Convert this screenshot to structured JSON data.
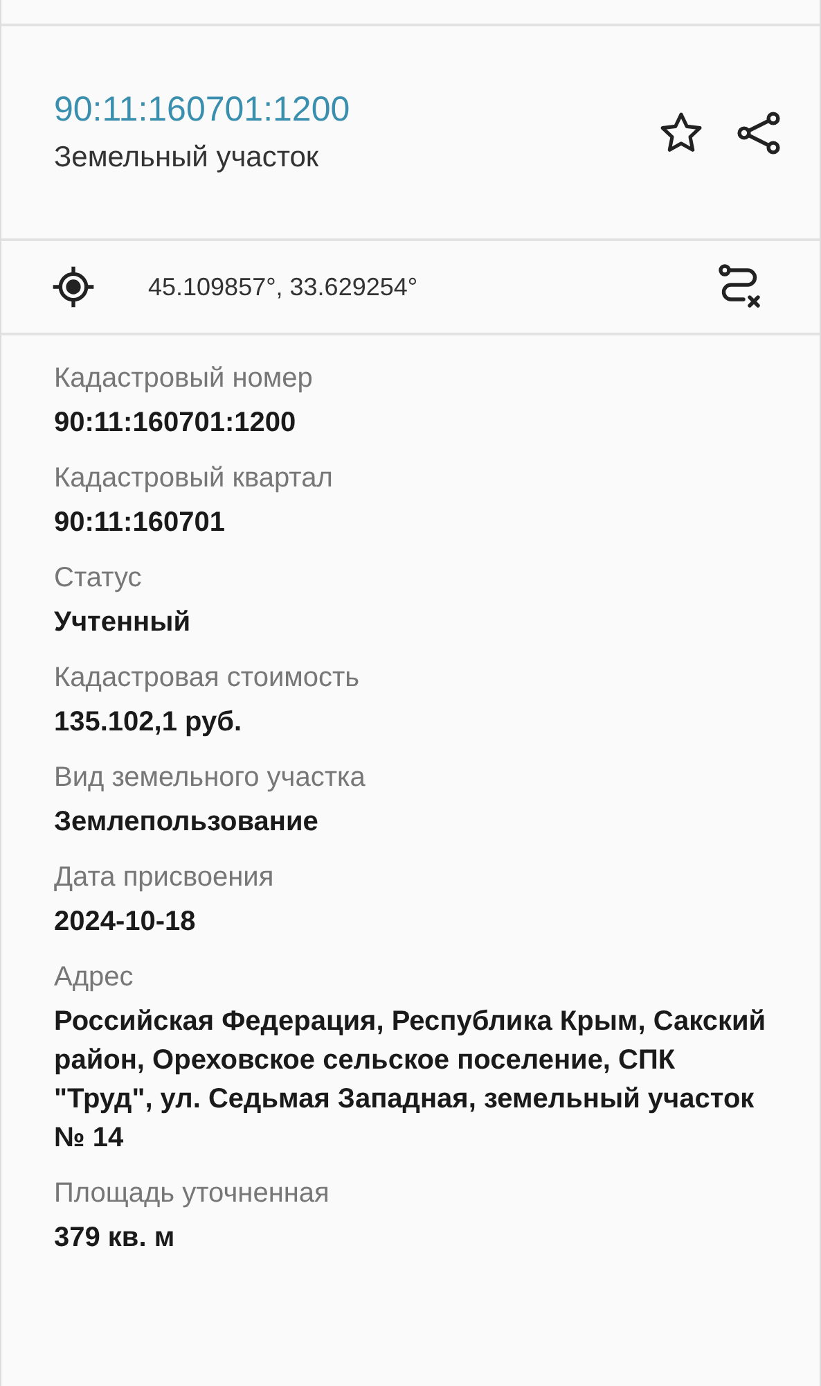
{
  "header": {
    "title": "90:11:160701:1200",
    "subtitle": "Земельный участок"
  },
  "coordinates": "45.109857°, 33.629254°",
  "fields": [
    {
      "label": "Кадастровый номер",
      "value": "90:11:160701:1200"
    },
    {
      "label": "Кадастровый квартал",
      "value": "90:11:160701"
    },
    {
      "label": "Статус",
      "value": "Учтенный"
    },
    {
      "label": "Кадастровая стоимость",
      "value": "135.102,1 руб."
    },
    {
      "label": "Вид земельного участка",
      "value": "Землепользование"
    },
    {
      "label": "Дата присвоения",
      "value": "2024-10-18"
    },
    {
      "label": "Адрес",
      "value": "Российская Федерация, Республика Крым, Сакский район, Ореховское сельское поселение, СПК \"Труд\", ул. Седьмая Западная, земельный участок № 14"
    },
    {
      "label": "Площадь уточненная",
      "value": "379 кв. м"
    }
  ]
}
